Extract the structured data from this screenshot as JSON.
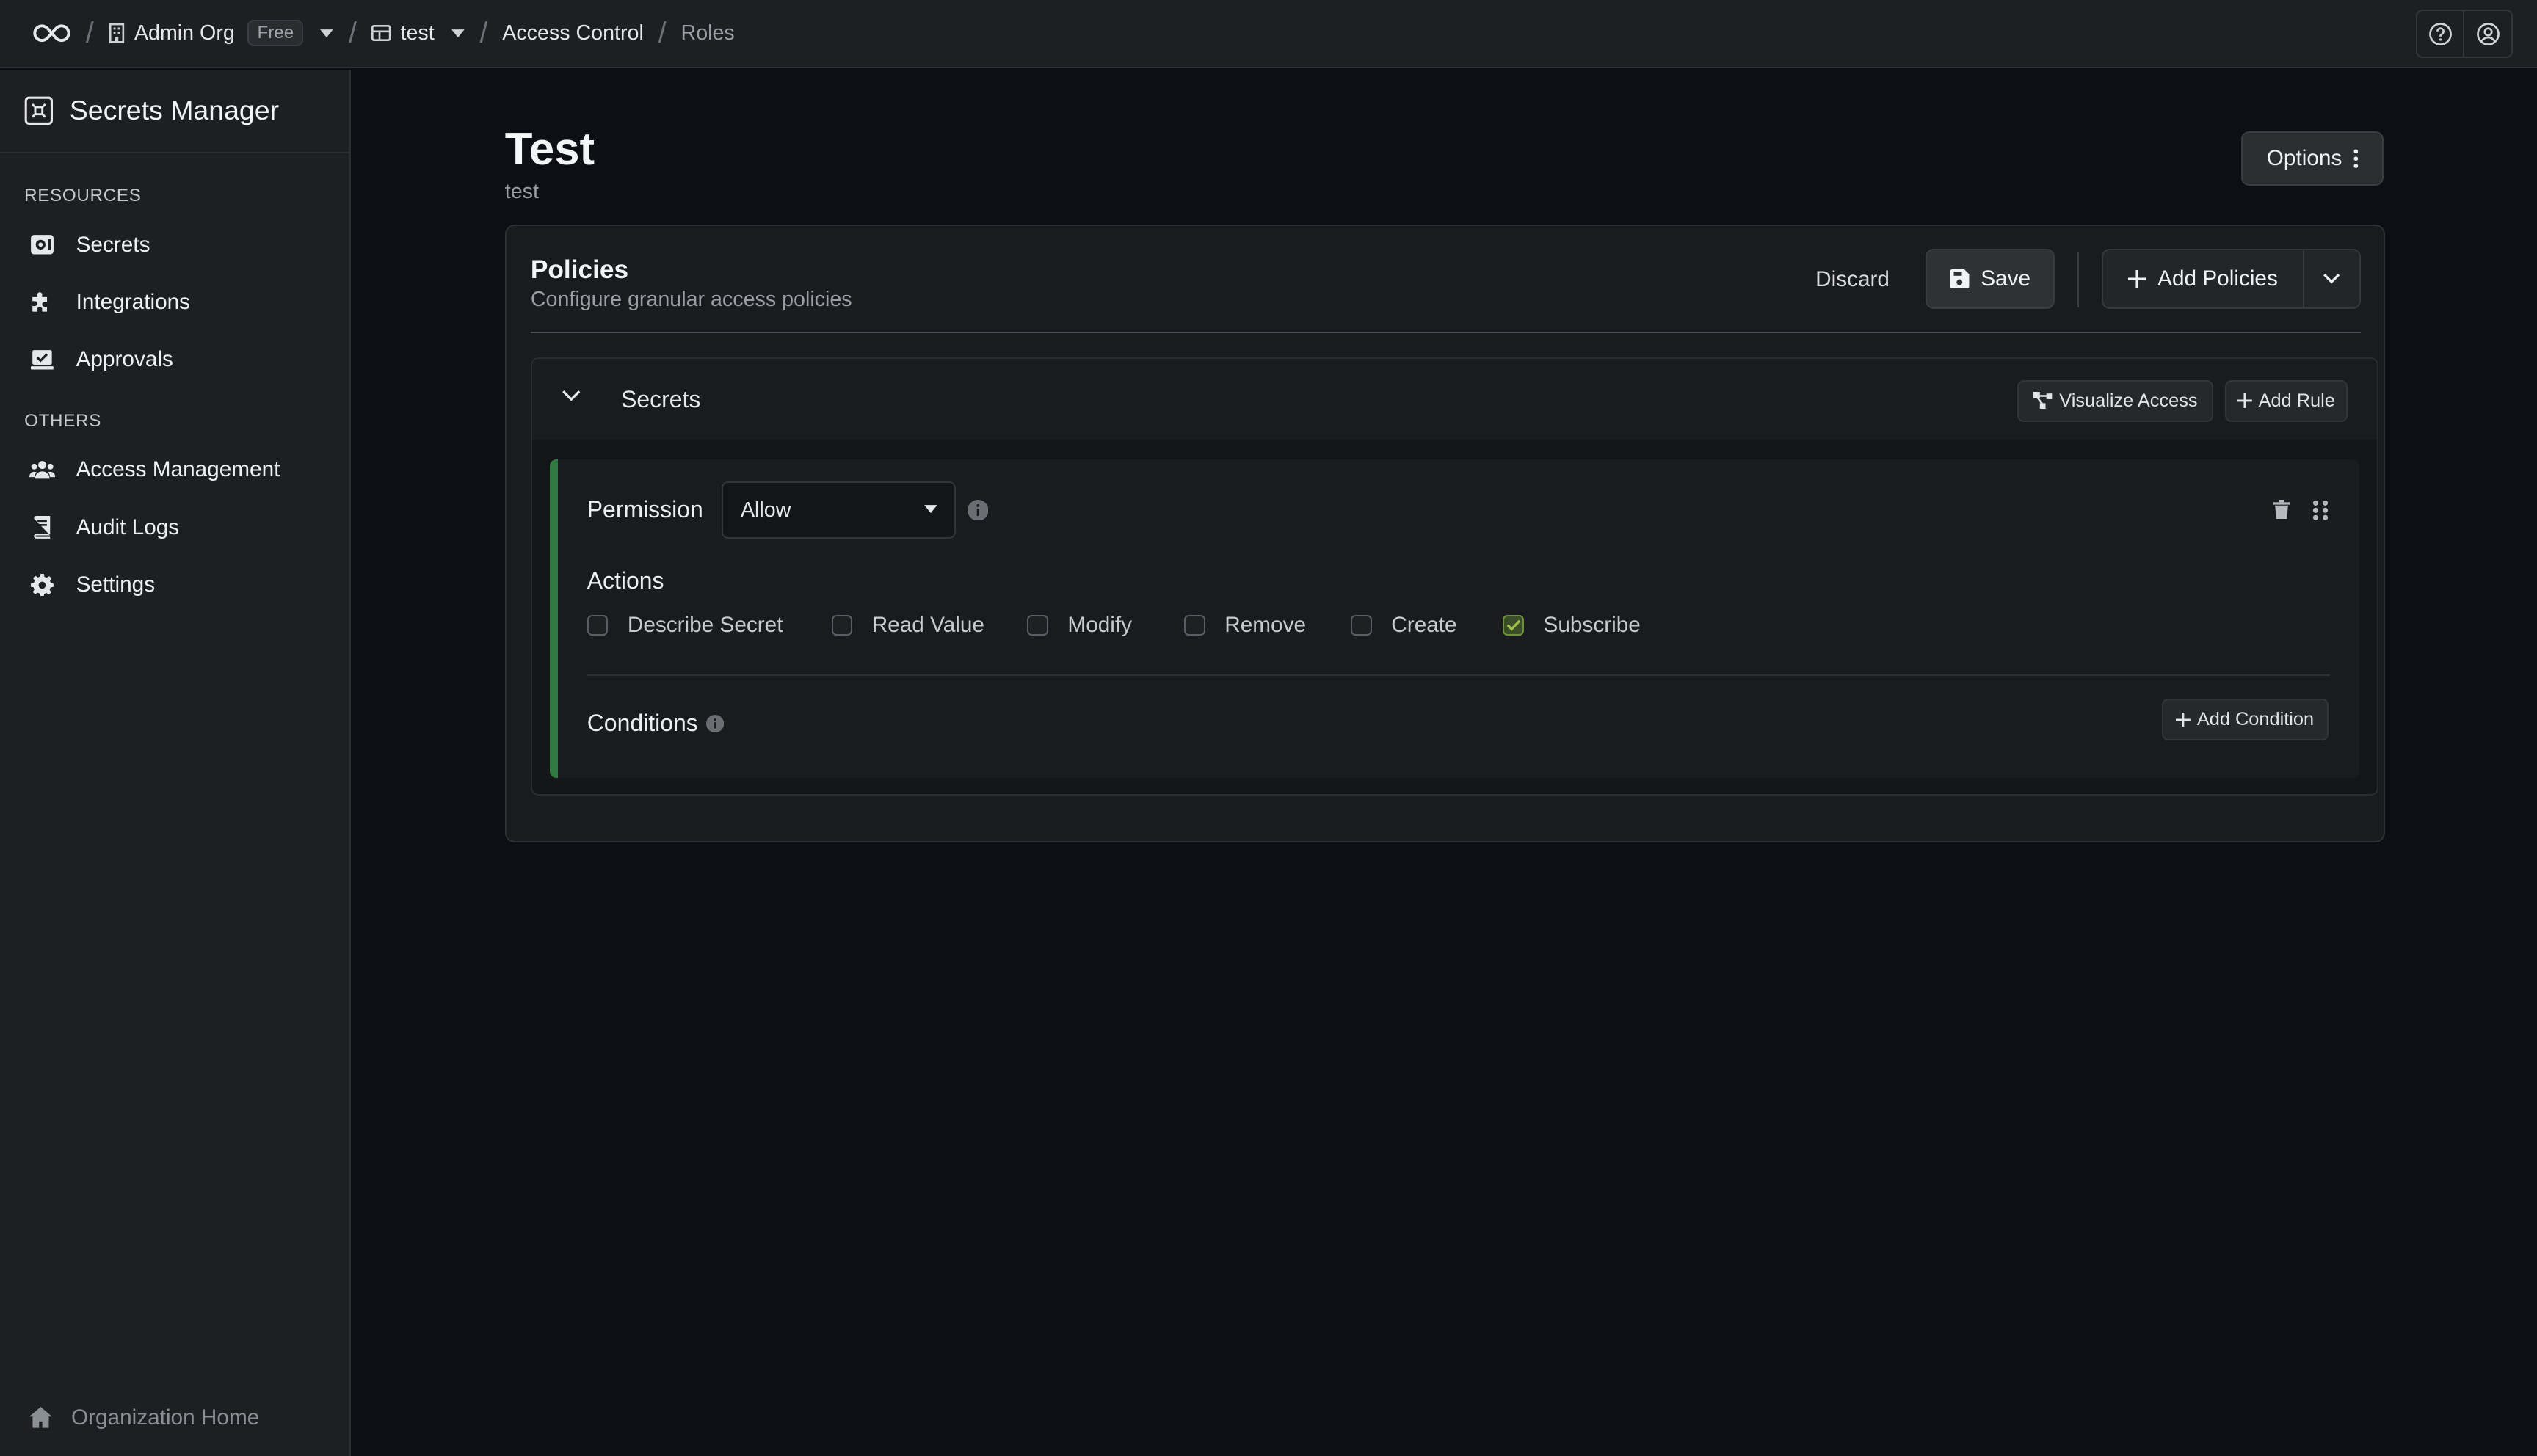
{
  "topbar": {
    "org_name": "Admin Org",
    "plan_badge": "Free",
    "project_name": "test",
    "crumb_access_control": "Access Control",
    "crumb_roles": "Roles",
    "separator": "/"
  },
  "sidebar": {
    "title": "Secrets Manager",
    "section_resources": "RESOURCES",
    "section_others": "OTHERS",
    "items": [
      {
        "label": "Secrets",
        "icon": "secrets-icon"
      },
      {
        "label": "Integrations",
        "icon": "puzzle-icon"
      },
      {
        "label": "Approvals",
        "icon": "approval-icon"
      },
      {
        "label": "Access Management",
        "icon": "users-icon"
      },
      {
        "label": "Audit Logs",
        "icon": "book-icon"
      },
      {
        "label": "Settings",
        "icon": "gear-icon"
      }
    ],
    "footer": "Organization Home"
  },
  "page": {
    "title": "Test",
    "subtitle": "test",
    "options_label": "Options"
  },
  "policies": {
    "title": "Policies",
    "subtitle": "Configure granular access policies",
    "discard_label": "Discard",
    "save_label": "Save",
    "add_policies_label": "Add Policies",
    "section": {
      "title": "Secrets",
      "visualize_label": "Visualize Access",
      "add_rule_label": "Add Rule",
      "rule": {
        "permission_label": "Permission",
        "permission_value": "Allow",
        "actions_label": "Actions",
        "actions": [
          {
            "label": "Describe Secret",
            "checked": false
          },
          {
            "label": "Read Value",
            "checked": false
          },
          {
            "label": "Modify",
            "checked": false
          },
          {
            "label": "Remove",
            "checked": false
          },
          {
            "label": "Create",
            "checked": false
          },
          {
            "label": "Subscribe",
            "checked": true
          }
        ],
        "conditions_label": "Conditions",
        "add_condition_label": "Add Condition"
      }
    }
  },
  "colors": {
    "accent_green": "#2f7a3e",
    "checked_fill": "#3b4e2a",
    "check_mark": "#a3c24a"
  }
}
